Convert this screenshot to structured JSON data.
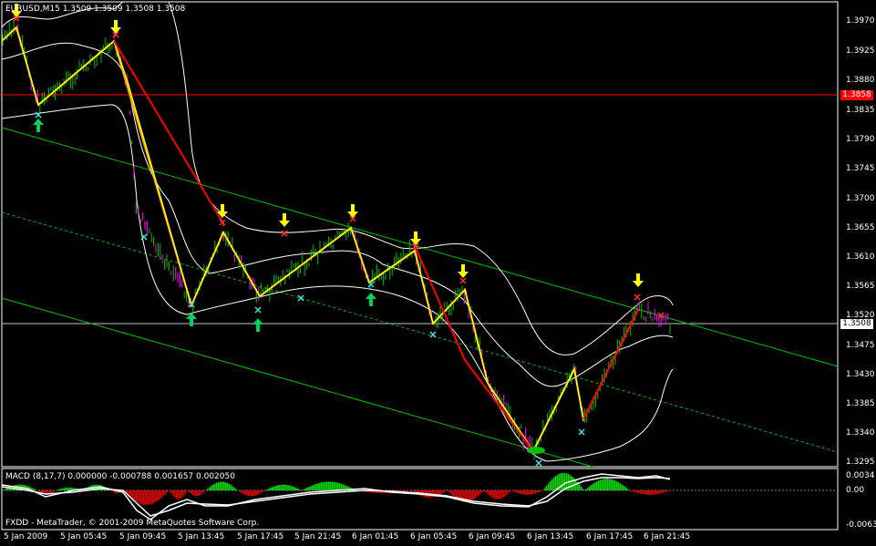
{
  "symbol_header": "EURUSD,M15  1.3509 1.3509 1.3508 1.3508",
  "macd_header": "MACD (8,17,7) 0.000000 -0.000788 0.001657 0.002050",
  "copyright": "FXDD - MetaTrader, © 2001-2009 MetaQuotes Software Corp.",
  "price_axis": [
    "1.3970",
    "1.3925",
    "1.3880",
    "1.3835",
    "1.3790",
    "1.3745",
    "1.3700",
    "1.3655",
    "1.3610",
    "1.3565",
    "1.3520",
    "1.3475",
    "1.3430",
    "1.3385",
    "1.3340",
    "1.3295"
  ],
  "hline_red_label": "1.3858",
  "current_price_label": "1.3508",
  "macd_axis": [
    "0.0034",
    "0.00",
    "-0.00637"
  ],
  "time_axis": [
    "5 Jan 2009",
    "5 Jan 05:45",
    "5 Jan 09:45",
    "5 Jan 13:45",
    "5 Jan 17:45",
    "5 Jan 21:45",
    "6 Jan 01:45",
    "6 Jan 05:45",
    "6 Jan 09:45",
    "6 Jan 13:45",
    "6 Jan 17:45",
    "6 Jan 21:45"
  ],
  "colors": {
    "background": "#000000",
    "bull_candle": "#00c000",
    "bear_candle": "#ff00ff",
    "zigzag_orange": "#ffa500",
    "zigzag_yellow": "#ffff00",
    "zigzag_red": "#ff0000",
    "channel": "#00c000",
    "bands": "#ffffff",
    "arrow_down": "#ffff00",
    "arrow_up": "#00d060",
    "cross_red": "#ff3030",
    "cross_cyan": "#40e0e0",
    "hline_red": "#ff0000",
    "macd_up": "#00e000",
    "macd_down": "#e00000"
  }
}
